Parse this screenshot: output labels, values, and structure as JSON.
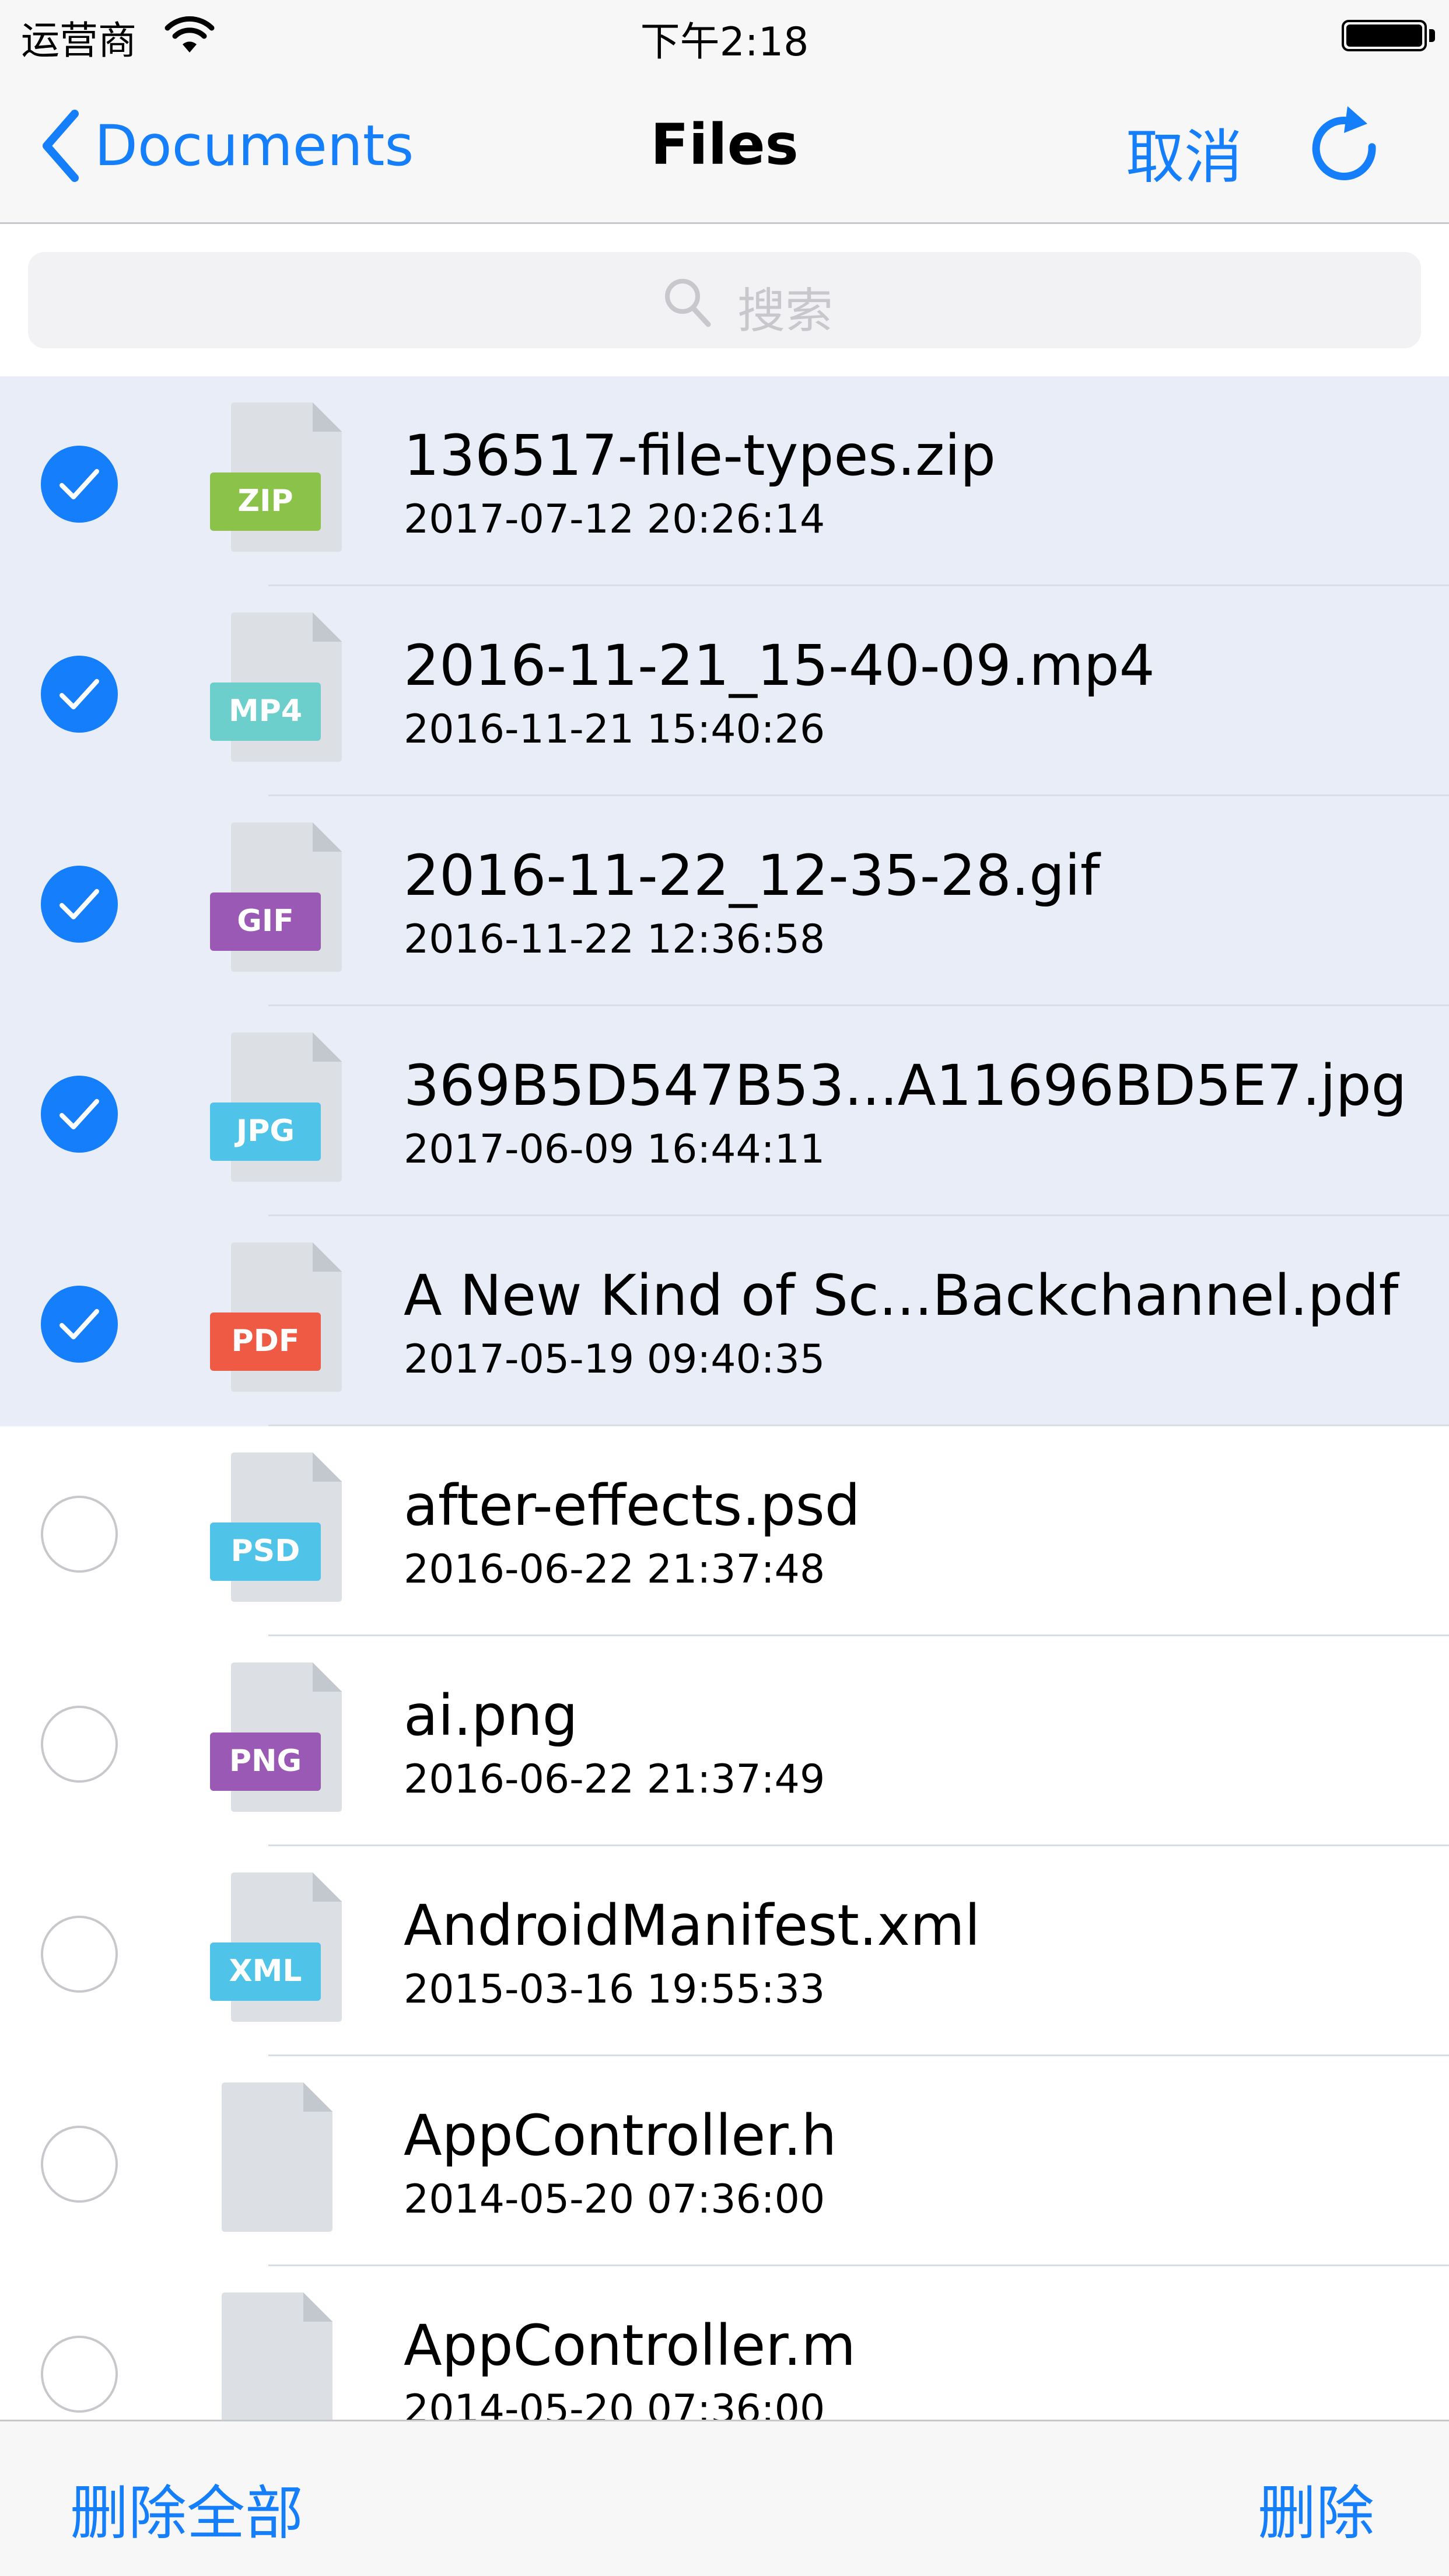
{
  "status_bar": {
    "carrier": "运营商",
    "time": "下午2:18",
    "wifi_icon": "wifi-icon",
    "battery_icon": "battery-icon"
  },
  "nav": {
    "back_label": "Documents",
    "title": "Files",
    "cancel_label": "取消",
    "refresh_icon": "refresh-icon"
  },
  "search": {
    "placeholder": "搜索"
  },
  "files": [
    {
      "name": "136517-file-types.zip",
      "date": "2017-07-12 20:26:14",
      "type": "ZIP",
      "badge_color": "#8bc34a",
      "selected": true
    },
    {
      "name": "2016-11-21_15-40-09.mp4",
      "date": "2016-11-21 15:40:26",
      "type": "MP4",
      "badge_color": "#6ccfcb",
      "selected": true
    },
    {
      "name": "2016-11-22_12-35-28.gif",
      "date": "2016-11-22 12:36:58",
      "type": "GIF",
      "badge_color": "#9b59b6",
      "selected": true
    },
    {
      "name": "369B5D547B53...A11696BD5E7.jpg",
      "date": "2017-06-09 16:44:11",
      "type": "JPG",
      "badge_color": "#4fc3e8",
      "selected": true
    },
    {
      "name": "A New Kind of Sc...Backchannel.pdf",
      "date": "2017-05-19 09:40:35",
      "type": "PDF",
      "badge_color": "#ef5a44",
      "selected": true
    },
    {
      "name": "after-effects.psd",
      "date": "2016-06-22 21:37:48",
      "type": "PSD",
      "badge_color": "#4fc3e8",
      "selected": false
    },
    {
      "name": "ai.png",
      "date": "2016-06-22 21:37:49",
      "type": "PNG",
      "badge_color": "#9b59b6",
      "selected": false
    },
    {
      "name": "AndroidManifest.xml",
      "date": "2015-03-16 19:55:33",
      "type": "XML",
      "badge_color": "#4fc3e8",
      "selected": false
    },
    {
      "name": "AppController.h",
      "date": "2014-05-20 07:36:00",
      "type": "",
      "badge_color": "",
      "selected": false
    },
    {
      "name": "AppController.m",
      "date": "2014-05-20 07:36:00",
      "type": "",
      "badge_color": "",
      "selected": false
    }
  ],
  "toolbar": {
    "delete_all_label": "删除全部",
    "delete_label": "删除"
  },
  "colors": {
    "accent": "#157efb",
    "selected_row": "#e8edf8",
    "file_page": "#dcdfe4",
    "file_fold": "#c3c7ce"
  }
}
